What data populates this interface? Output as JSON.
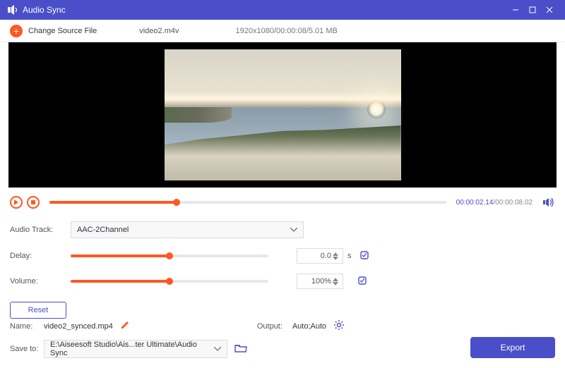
{
  "window": {
    "title": "Audio Sync"
  },
  "top": {
    "change_label": "Change Source File",
    "filename": "video2.m4v",
    "meta": "1920x1080/00:00:08/5.01 MB"
  },
  "player": {
    "current": "00:00:02.14",
    "total": "/00:00:08.02"
  },
  "audio": {
    "track_label": "Audio Track:",
    "track_value": "AAC-2Channel",
    "delay_label": "Delay:",
    "delay_value": "0.0",
    "delay_unit": "s",
    "volume_label": "Volume:",
    "volume_value": "100%"
  },
  "reset_label": "Reset",
  "name_label": "Name:",
  "name_value": "video2_synced.mp4",
  "output_label": "Output:",
  "output_value": "Auto;Auto",
  "save_label": "Save to:",
  "save_path": "E:\\Aiseesoft Studio\\Ais...ter Ultimate\\Audio Sync",
  "export_label": "Export"
}
